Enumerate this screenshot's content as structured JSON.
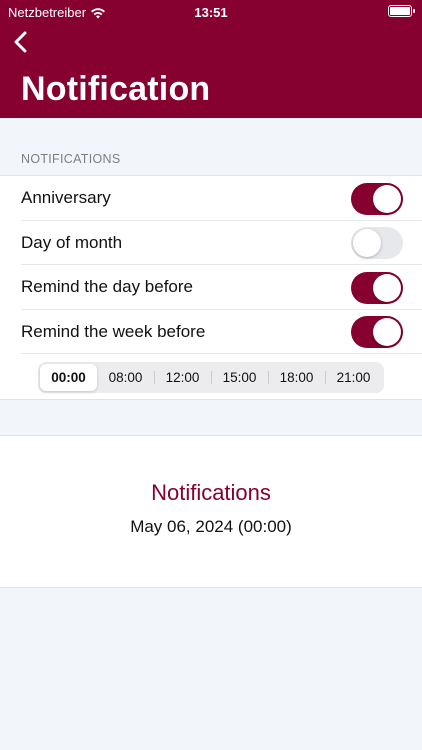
{
  "status_bar": {
    "carrier": "Netzbetreiber",
    "time": "13:51"
  },
  "header": {
    "title": "Notification",
    "background_color": "#860030"
  },
  "section": {
    "label": "NOTIFICATIONS"
  },
  "settings": [
    {
      "label": "Anniversary",
      "enabled": true
    },
    {
      "label": "Day of month",
      "enabled": false
    },
    {
      "label": "Remind the day before",
      "enabled": true
    },
    {
      "label": "Remind the week before",
      "enabled": true
    }
  ],
  "time_picker": {
    "options": [
      "00:00",
      "08:00",
      "12:00",
      "15:00",
      "18:00",
      "21:00"
    ],
    "selected": "00:00"
  },
  "summary": {
    "title": "Notifications",
    "date": "May 06, 2024 (00:00)"
  },
  "icons": [
    "wifi-icon",
    "battery-icon",
    "back-chevron-icon"
  ],
  "colors": {
    "accent": "#860030",
    "toggle_off": "#e6e8eb"
  }
}
